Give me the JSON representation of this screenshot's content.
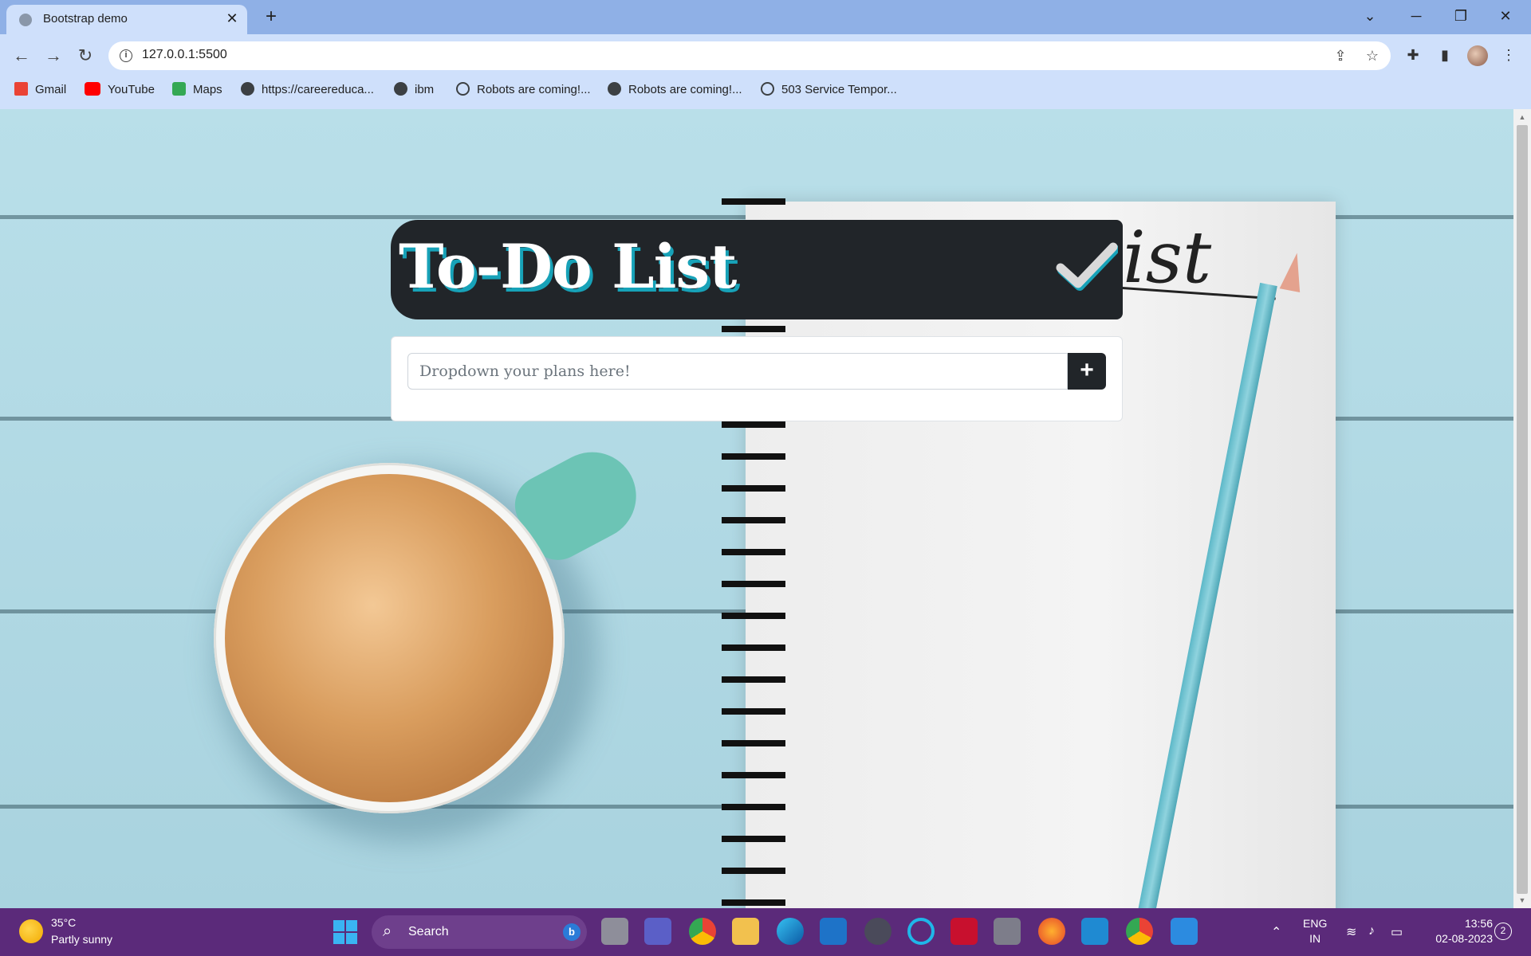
{
  "browser": {
    "tab_title": "Bootstrap demo",
    "new_tab_symbol": "+",
    "url": "127.0.0.1:5500",
    "window_controls": [
      "minimize",
      "restore",
      "close"
    ]
  },
  "bookmarks": [
    {
      "label": "Gmail",
      "icon": "gmail-icon"
    },
    {
      "label": "YouTube",
      "icon": "youtube-icon"
    },
    {
      "label": "Maps",
      "icon": "maps-icon"
    },
    {
      "label": "https://careereduca...",
      "icon": "globe-icon"
    },
    {
      "label": "ibm",
      "icon": "globe-icon"
    },
    {
      "label": "Robots are coming!...",
      "icon": "sparkle-icon"
    },
    {
      "label": "Robots are coming!...",
      "icon": "globe-icon"
    },
    {
      "label": "503 Service Tempor...",
      "icon": "sparkle-icon"
    }
  ],
  "app": {
    "title": "To-Do List",
    "input_placeholder": "Dropdown your plans here!",
    "add_button_label": "+",
    "background_script_text": "ist",
    "colors": {
      "header_bg": "#212529",
      "title_shadow": "#17a2b8",
      "button_bg": "#212529"
    }
  },
  "taskbar": {
    "weather_temp": "35°C",
    "weather_desc": "Partly sunny",
    "search_label": "Search",
    "language_line1": "ENG",
    "language_line2": "IN",
    "time": "13:56",
    "date": "02-08-2023",
    "notification_count": "2"
  }
}
